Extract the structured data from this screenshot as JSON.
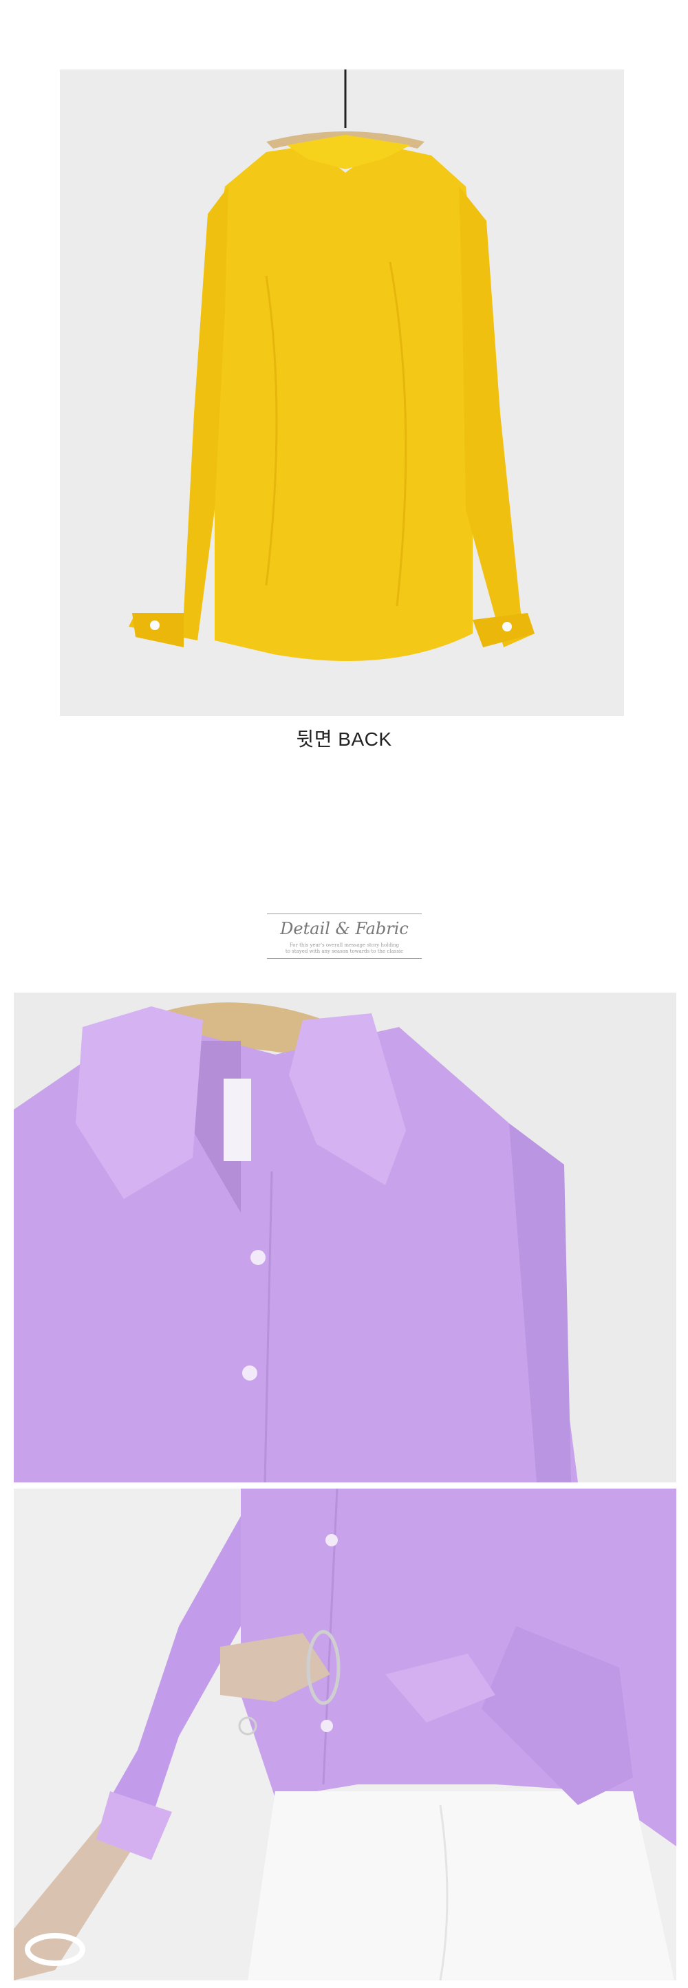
{
  "back_section": {
    "caption": "뒷면 BACK",
    "photo_subject": "yellow-shirt-back-on-hanger"
  },
  "detail_badge": {
    "title": "Detail & Fabric",
    "subtitle_line1": "For this year's overall message story holding",
    "subtitle_line2": "to stayed with any season towards to the classic"
  },
  "detail_photos": [
    {
      "subject": "lavender-shirt-collar-closeup"
    },
    {
      "subject": "lavender-shirt-worn-cuff-detail"
    }
  ],
  "colors": {
    "page_background": "#ffffff",
    "shirt_yellow": "#f4c816",
    "shirt_lavender": "#c8a2ea",
    "hanger_wood": "#d8b988"
  }
}
